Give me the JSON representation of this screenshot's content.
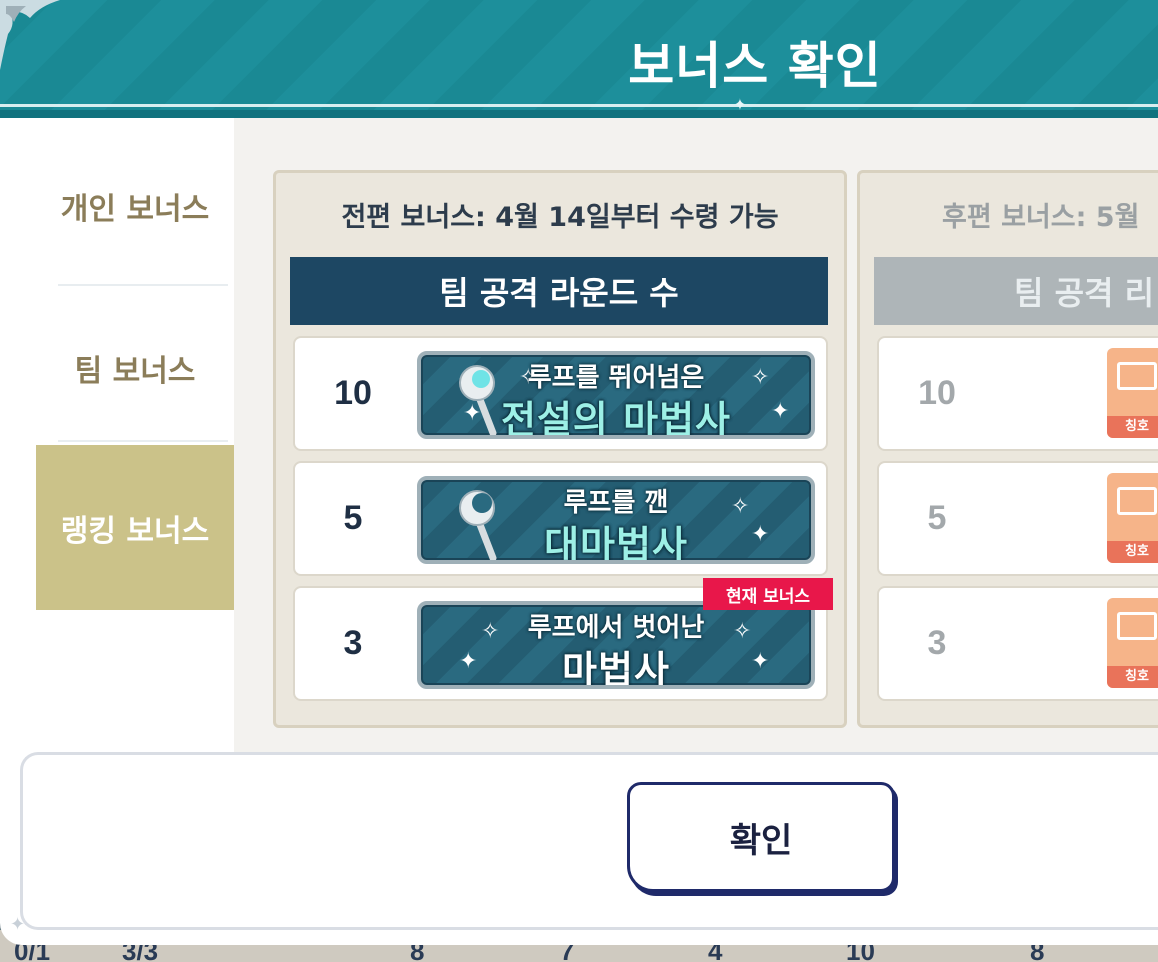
{
  "dialog": {
    "title": "보너스 확인",
    "confirm_label": "확인"
  },
  "sidebar": {
    "items": [
      {
        "label": "개인 보너스",
        "active": false
      },
      {
        "label": "팀 보너스",
        "active": false
      },
      {
        "label": "랭킹 보너스",
        "active": true
      }
    ]
  },
  "panels": [
    {
      "subtitle": "전편 보너스: 4월 14일부터 수령 가능",
      "header": "팀 공격 라운드 수",
      "rows": [
        {
          "rounds": "10",
          "title_line1": "루프를 뛰어넘은",
          "title_line2": "전설의 마법사"
        },
        {
          "rounds": "5",
          "title_line1": "루프를 깬",
          "title_line2": "대마법사"
        },
        {
          "rounds": "3",
          "title_line1": "루프에서 벗어난",
          "title_line2": "마법사",
          "current_label": "현재 보너스"
        }
      ]
    },
    {
      "subtitle": "후편 보너스: 5월",
      "header": "팀 공격 리",
      "rows": [
        {
          "rounds": "10",
          "icon_label": "칭호"
        },
        {
          "rounds": "5",
          "icon_label": "칭호"
        },
        {
          "rounds": "3",
          "icon_label": "칭호"
        }
      ]
    }
  ],
  "background_strip": [
    "0/1",
    "3/3",
    "8",
    "7",
    "4",
    "10",
    "8"
  ],
  "colors": {
    "header_teal": "#1a8994",
    "navy_header": "#1d4763",
    "active_tab": "#cbc289",
    "current_tag": "#e8174a",
    "badge_title_cyan": "#9df0e6"
  }
}
